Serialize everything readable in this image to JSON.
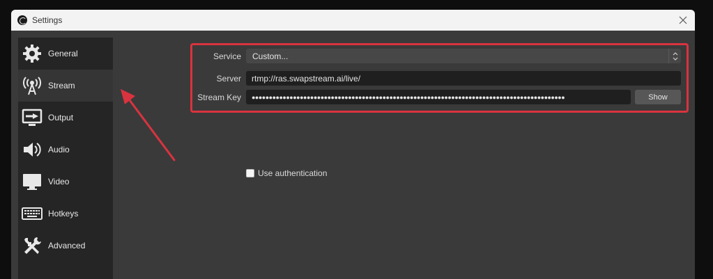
{
  "window": {
    "title": "Settings",
    "icons": {
      "app": "obs-logo-icon",
      "close": "close-icon"
    }
  },
  "sidebar": {
    "items": [
      {
        "label": "General",
        "icon": "gear-icon"
      },
      {
        "label": "Stream",
        "icon": "broadcast-antenna-icon",
        "active": true
      },
      {
        "label": "Output",
        "icon": "monitor-output-icon"
      },
      {
        "label": "Audio",
        "icon": "speaker-icon"
      },
      {
        "label": "Video",
        "icon": "monitor-icon"
      },
      {
        "label": "Hotkeys",
        "icon": "keyboard-icon"
      },
      {
        "label": "Advanced",
        "icon": "wrench-screwdriver-icon"
      }
    ]
  },
  "stream": {
    "service_label": "Service",
    "service_value": "Custom...",
    "server_label": "Server",
    "server_value": "rtmp://ras.swapstream.ai/live/",
    "key_label": "Stream Key",
    "key_value": "●●●●●●●●●●●●●●●●●●●●●●●●●●●●●●●●●●●●●●●●●●●●●●●●●●●●●●●●●●●●●●●●●●●●●●●●●●●●●●●●●●●●●●●●●●●",
    "show_button": "Show",
    "use_auth_label": "Use authentication",
    "use_auth_checked": false
  },
  "annotation": {
    "color": "#d9333f"
  }
}
